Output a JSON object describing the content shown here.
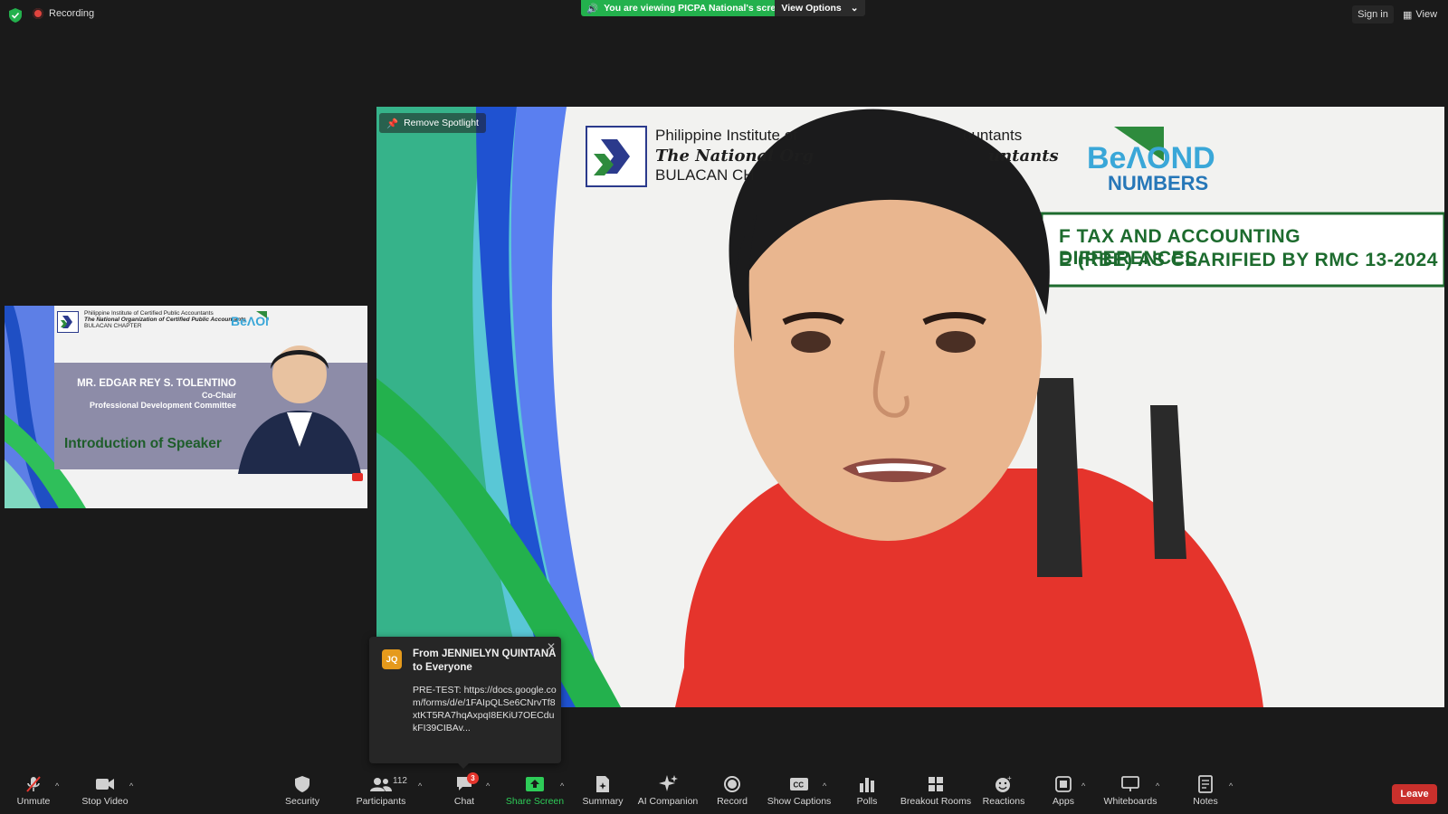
{
  "topbar": {
    "recording_label": "Recording",
    "viewing_label": "You are viewing PICPA National's screen",
    "view_options_label": "View Options",
    "sign_in_label": "Sign in",
    "view_label": "View"
  },
  "thumbnail": {
    "org_line1": "Philippine Institute of Certified Public Accountants",
    "org_line2": "The National Organization of Certified Public Accountants",
    "org_line3": "BULACAN CHAPTER",
    "speaker_name": "MR. EDGAR REY S. TOLENTINO",
    "speaker_role1": "Co-Chair",
    "speaker_role2": "Professional Development Committee",
    "intro_label": "Introduction of Speaker",
    "brand_logo": "beyond-numbers-logo"
  },
  "main_video": {
    "remove_spotlight_label": "Remove Spotlight",
    "org_line1": "Philippine Institute of",
    "org_line1_end": "ountants",
    "org_line2": "The National Org",
    "org_line2_end": "untants",
    "org_line3": "BULACAN CH",
    "title_line1": "F TAX AND ACCOUNTING DIFFERENCES",
    "title_line2": "E (RBE) AS CLARIFIED BY RMC 13-2024"
  },
  "chat_toast": {
    "avatar_initials": "JQ",
    "from_line": "From JENNIELYN QUINTANA to Everyone",
    "message": "PRE-TEST: https://docs.google.com/forms/d/e/1FAIpQLSe6CNrvTf8xtKT5RA7hqAxpqI8EKiU7OECdukFI39CIBAv..."
  },
  "toolbar": {
    "unmute_label": "Unmute",
    "stop_video_label": "Stop Video",
    "security_label": "Security",
    "participants_label": "Participants",
    "participants_count": "112",
    "chat_label": "Chat",
    "chat_badge": "3",
    "share_screen_label": "Share Screen",
    "summary_label": "Summary",
    "ai_companion_label": "AI Companion",
    "record_label": "Record",
    "show_captions_label": "Show Captions",
    "polls_label": "Polls",
    "breakout_rooms_label": "Breakout Rooms",
    "reactions_label": "Reactions",
    "apps_label": "Apps",
    "whiteboards_label": "Whiteboards",
    "notes_label": "Notes",
    "leave_label": "Leave"
  },
  "colors": {
    "background": "#1a1a1a",
    "screen_share_green": "#23b14d",
    "leave_red": "#c9302c",
    "chat_badge_red": "#e5352d",
    "avatar_orange": "#e59a1c"
  }
}
